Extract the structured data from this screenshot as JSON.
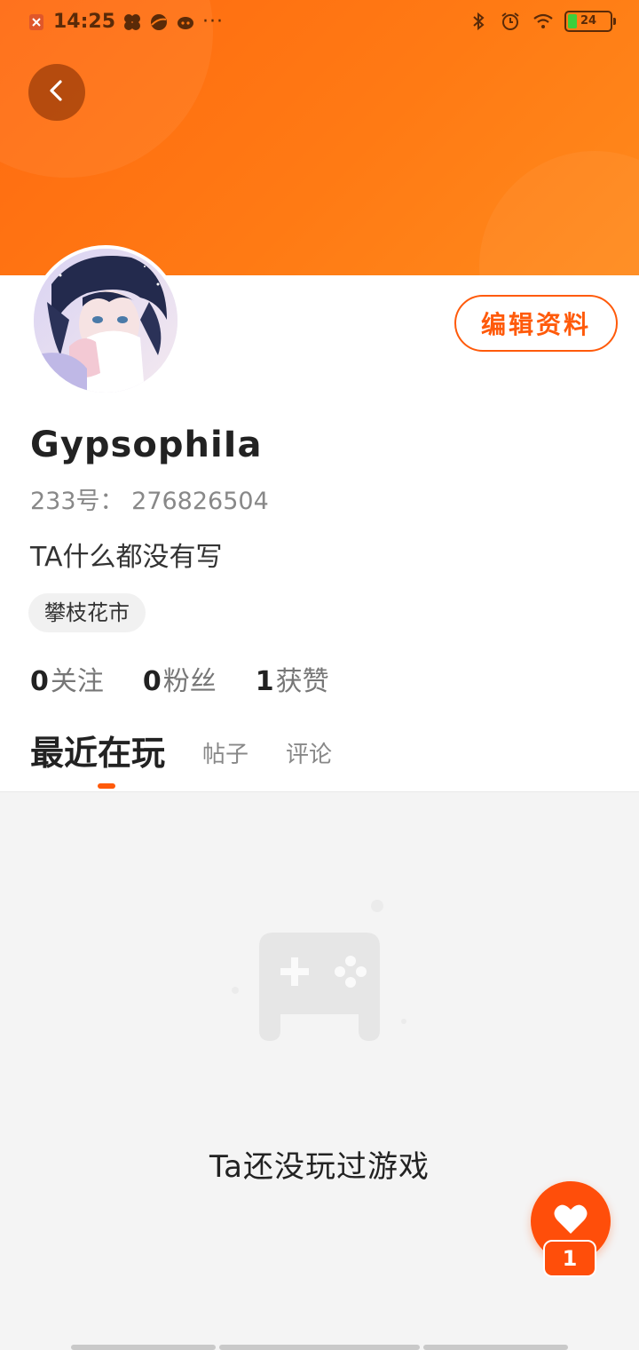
{
  "status_bar": {
    "time": "14:25",
    "battery": "24"
  },
  "profile": {
    "edit_label": "编辑资料",
    "username": "GypsophiIa",
    "uid_label": "233号：",
    "uid_value": "276826504",
    "bio": "TA什么都没有写",
    "tag": "攀枝花市",
    "stats": [
      {
        "value": "0",
        "label": "关注"
      },
      {
        "value": "0",
        "label": "粉丝"
      },
      {
        "value": "1",
        "label": "获赞"
      }
    ]
  },
  "tabs": [
    {
      "label": "最近在玩",
      "active": true
    },
    {
      "label": "帖子",
      "active": false
    },
    {
      "label": "评论",
      "active": false
    }
  ],
  "empty_state": {
    "message": "Ta还没玩过游戏"
  },
  "like": {
    "count": "1"
  },
  "colors": {
    "accent": "#ff5a0a",
    "header_start": "#ff6a10",
    "header_end": "#ff8a1c"
  }
}
